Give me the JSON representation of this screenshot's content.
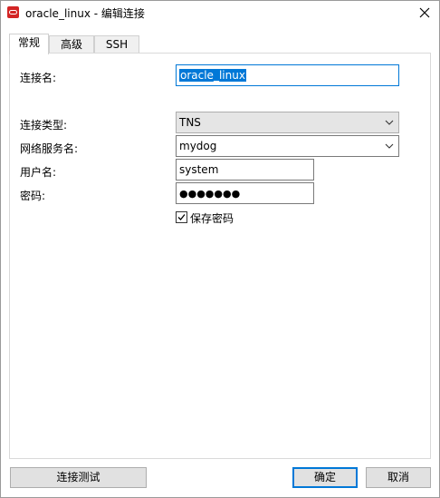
{
  "window": {
    "title": "oracle_linux - 编辑连接"
  },
  "tabs": [
    {
      "label": "常规",
      "active": true
    },
    {
      "label": "高级",
      "active": false
    },
    {
      "label": "SSH",
      "active": false
    }
  ],
  "form": {
    "connection_name_label": "连接名:",
    "connection_name_value": "oracle_linux",
    "connection_type_label": "连接类型:",
    "connection_type_value": "TNS",
    "net_service_label": "网络服务名:",
    "net_service_value": "mydog",
    "username_label": "用户名:",
    "username_value": "system",
    "password_label": "密码:",
    "password_value": "●●●●●●●",
    "save_password_label": "保存密码",
    "save_password_checked": true
  },
  "buttons": {
    "test_connection": "连接测试",
    "ok": "确定",
    "cancel": "取消"
  },
  "colors": {
    "accent": "#0078d7",
    "app_icon": "#d32525"
  }
}
